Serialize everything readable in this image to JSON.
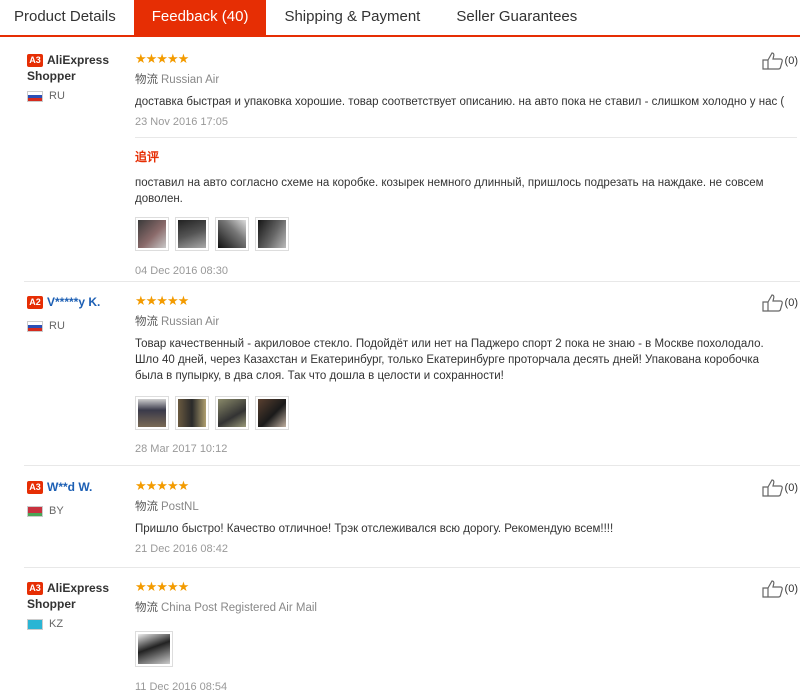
{
  "tabs": [
    "Product Details",
    "Feedback (40)",
    "Shipping & Payment",
    "Seller Guarantees"
  ],
  "logistics_label": "物流",
  "followup_label": "追评",
  "reviews": [
    {
      "level": "A3",
      "user": "AliExpress Shopper",
      "country": "RU",
      "rating": 5,
      "logistics": "Russian Air",
      "text": "доставка быстрая и упаковка хорошие. товар соответствует описанию. на авто пока не ставил - слишком холодно у нас (",
      "date": "23 Nov 2016 17:05",
      "likes": "(0)",
      "followup": {
        "text": "поставил на авто согласно схеме на коробке. козырек немного длинный, пришлось подрезать на наждаке. не совсем доволен.",
        "date": "04 Dec 2016 08:30"
      }
    },
    {
      "level": "A2",
      "user": "V*****y K.",
      "country": "RU",
      "rating": 5,
      "logistics": "Russian Air",
      "text": "Товар качественный - акриловое стекло. Подойдёт или нет на Паджеро спорт 2 пока не знаю - в Москве похолодало. Шло 40 дней, через Казахстан и Екатеринбург, только Екатеринбурге проторчала десять дней! Упакована коробочка была в пупырку, в два слоя. Так что дошла в целости и сохранности!",
      "date": "28 Mar 2017 10:12",
      "likes": "(0)"
    },
    {
      "level": "A3",
      "user": "W**d W.",
      "country": "BY",
      "rating": 5,
      "logistics": "PostNL",
      "text": "Пришло быстро! Качество отличное! Трэк отслеживался всю дорогу. Рекомендую всем!!!!",
      "date": "21 Dec 2016 08:42",
      "likes": "(0)"
    },
    {
      "level": "A3",
      "user": "AliExpress Shopper",
      "country": "KZ",
      "rating": 5,
      "logistics": "China Post Registered Air Mail",
      "text": "",
      "date": "11 Dec 2016 08:54",
      "likes": "(0)"
    }
  ],
  "colors": {
    "accent": "#e62e04",
    "star": "#f39b00",
    "masked_user": "#1c5fb4"
  }
}
